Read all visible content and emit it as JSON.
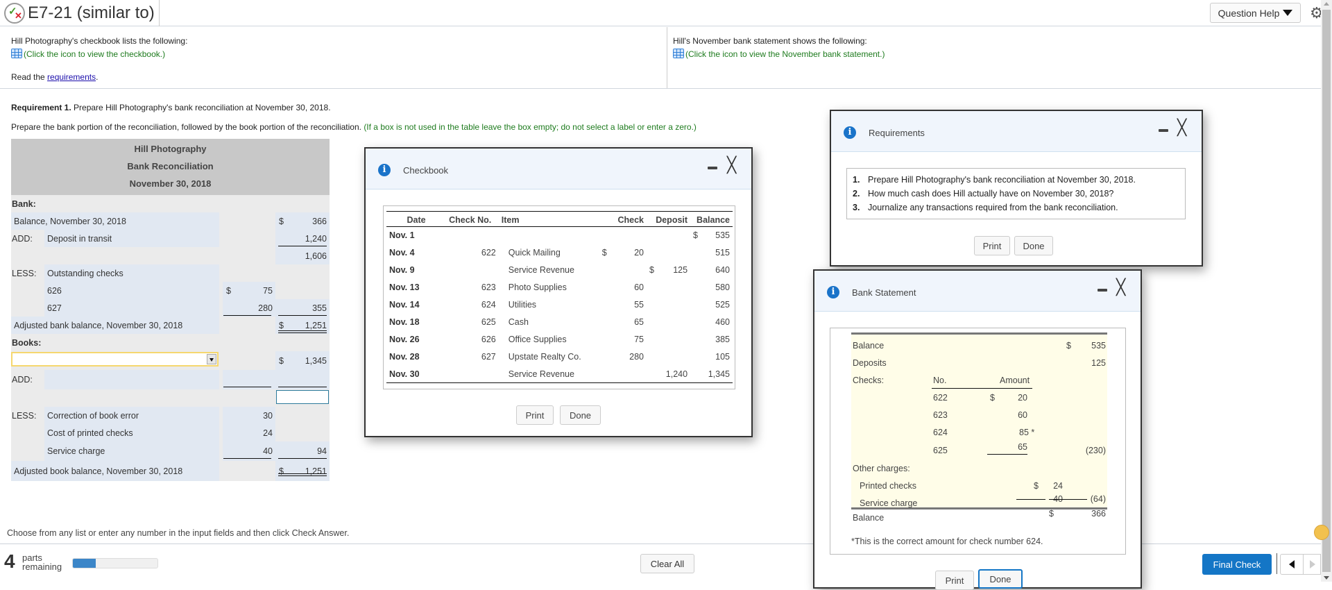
{
  "header": {
    "title": "E7-21 (similar to)",
    "question_help": "Question Help",
    "status_icon": "partial-correct-icon",
    "settings_icon": "gear-icon"
  },
  "intro": {
    "checkbook_text": "Hill Photography's checkbook lists the following:",
    "checkbook_link": "(Click the icon to view the checkbook.)",
    "bank_text": "Hill's November bank statement shows the following:",
    "bank_link": "(Click the icon to view the November bank statement.)",
    "read_prefix": "Read the ",
    "read_link": "requirements",
    "read_suffix": "."
  },
  "requirement": {
    "label": "Requirement 1.",
    "text": " Prepare Hill Photography's bank reconciliation at November 30, 2018.",
    "instruction": "Prepare the bank portion of the reconciliation, followed by the book portion of the reconciliation. ",
    "hint": "(If a box is not used in the table leave the box empty; do not select a label or enter a zero.)"
  },
  "recon": {
    "company": "Hill Photography",
    "title": "Bank Reconciliation",
    "date": "November 30, 2018",
    "bank_label": "Bank:",
    "bank_balance_label": "Balance, November 30, 2018",
    "bank_balance_dollar": "$",
    "bank_balance": "366",
    "add_label": "ADD:",
    "deposit_label": "Deposit in transit",
    "deposit_value": "1,240",
    "subtotal": "1,606",
    "less_label": "LESS:",
    "outstanding_label": "Outstanding checks",
    "check1_no": "626",
    "check1_dollar": "$",
    "check1_amt": "75",
    "check2_no": "627",
    "check2_amt": "280",
    "checks_total": "355",
    "adj_bank_label": "Adjusted bank balance, November 30, 2018",
    "adj_bank_dollar": "$",
    "adj_bank_value": "1,251",
    "books_label": "Books:",
    "books_select_value": "",
    "books_balance_dollar": "$",
    "books_balance": "1,345",
    "books_add_label": "ADD:",
    "books_subtotal_input": "",
    "books_less_label": "LESS:",
    "less_items": [
      {
        "label": "Correction of book error",
        "amount": "30"
      },
      {
        "label": "Cost of printed checks",
        "amount": "24"
      },
      {
        "label": "Service charge",
        "amount": "40"
      }
    ],
    "less_total": "94",
    "adj_book_label": "Adjusted book balance, November 30, 2018",
    "adj_book_dollar": "$",
    "adj_book_value": "1,251"
  },
  "checkbook_modal": {
    "title": "Checkbook",
    "headers": [
      "Date",
      "Check No.",
      "Item",
      "Check",
      "Deposit",
      "Balance"
    ],
    "rows": [
      {
        "date": "Nov. 1",
        "no": "",
        "item": "",
        "check": "",
        "deposit": "",
        "balance": "535",
        "bal_dollar": "$"
      },
      {
        "date": "Nov. 4",
        "no": "622",
        "item": "Quick Mailing",
        "check": "20",
        "check_dollar": "$",
        "deposit": "",
        "balance": "515"
      },
      {
        "date": "Nov. 9",
        "no": "",
        "item": "Service Revenue",
        "check": "",
        "deposit": "125",
        "dep_dollar": "$",
        "balance": "640"
      },
      {
        "date": "Nov. 13",
        "no": "623",
        "item": "Photo Supplies",
        "check": "60",
        "deposit": "",
        "balance": "580"
      },
      {
        "date": "Nov. 14",
        "no": "624",
        "item": "Utilities",
        "check": "55",
        "deposit": "",
        "balance": "525"
      },
      {
        "date": "Nov. 18",
        "no": "625",
        "item": "Cash",
        "check": "65",
        "deposit": "",
        "balance": "460"
      },
      {
        "date": "Nov. 26",
        "no": "626",
        "item": "Office Supplies",
        "check": "75",
        "deposit": "",
        "balance": "385"
      },
      {
        "date": "Nov. 28",
        "no": "627",
        "item": "Upstate Realty Co.",
        "check": "280",
        "deposit": "",
        "balance": "105"
      },
      {
        "date": "Nov. 30",
        "no": "",
        "item": "Service Revenue",
        "check": "",
        "deposit": "1,240",
        "balance": "1,345"
      }
    ],
    "print": "Print",
    "done": "Done"
  },
  "requirements_modal": {
    "title": "Requirements",
    "items": [
      {
        "num": "1.",
        "text": "Prepare Hill Photography's bank reconciliation at November 30, 2018."
      },
      {
        "num": "2.",
        "text": "How much cash does Hill actually have on November 30, 2018?"
      },
      {
        "num": "3.",
        "text": "Journalize any transactions required from the bank reconciliation."
      }
    ],
    "print": "Print",
    "done": "Done"
  },
  "bank_modal": {
    "title": "Bank Statement",
    "balance_label": "Balance",
    "balance_dollar": "$",
    "balance": "535",
    "deposits_label": "Deposits",
    "deposits": "125",
    "checks_label": "Checks:",
    "no_header": "No.",
    "amount_header": "Amount",
    "checks": [
      {
        "no": "622",
        "dollar": "$",
        "amount": "20"
      },
      {
        "no": "623",
        "amount": "60"
      },
      {
        "no": "624",
        "amount": "85 *"
      },
      {
        "no": "625",
        "amount": "65"
      }
    ],
    "checks_total": "(230)",
    "other_label": "Other charges:",
    "printed_label": "Printed checks",
    "printed_dollar": "$",
    "printed": "24",
    "service_label": "Service charge",
    "service": "40",
    "other_total": "(64)",
    "end_label": "Balance",
    "end_dollar": "$",
    "end_balance": "366",
    "footnote": "*This is the correct amount for check number 624.",
    "print": "Print",
    "done": "Done"
  },
  "footer": {
    "instruction": "Choose from any list or enter any number in the input fields and then click Check Answer.",
    "parts_count": "4",
    "parts_label_1": "parts",
    "parts_label_2": "remaining",
    "progress_percent": 27,
    "clear_all": "Clear All",
    "final_check": "Final Check"
  }
}
